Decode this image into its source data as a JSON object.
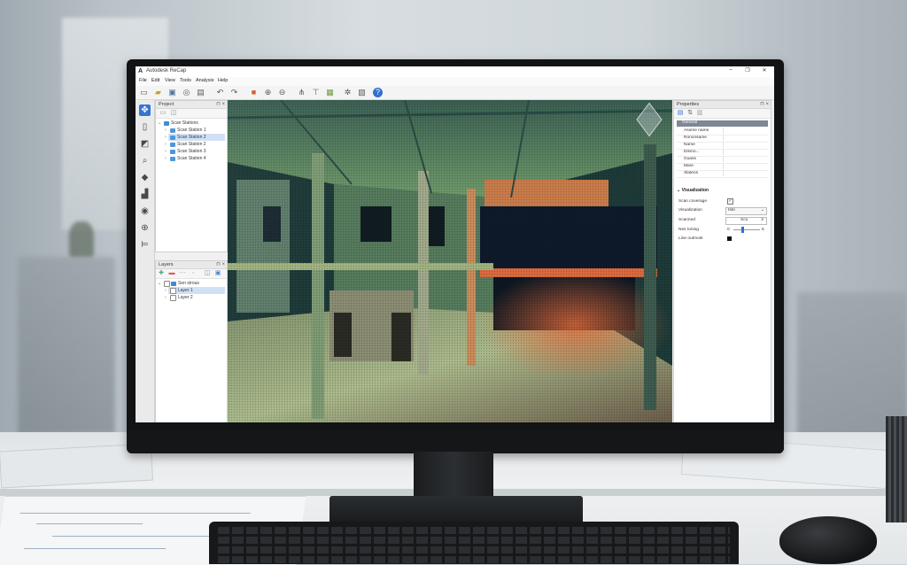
{
  "window": {
    "title": "Autodesk ReCap",
    "logo": "A",
    "controls": [
      "–",
      "❐",
      "✕"
    ]
  },
  "menu": {
    "items": [
      "File",
      "Edit",
      "View",
      "Tools",
      "Analysis",
      "Help"
    ]
  },
  "toolbar": {
    "icons": [
      "new-icon",
      "open-icon",
      "save-icon",
      "search-scan-icon",
      "print-icon",
      "undo-icon",
      "redo-icon",
      "cube-color-icon",
      "zoom-in-icon",
      "zoom-out-icon",
      "hierarchy-icon",
      "filter-icon",
      "chart-icon",
      "settings-icon",
      "report-icon",
      "help-icon"
    ]
  },
  "left_tools": {
    "icons": [
      "move-icon",
      "document-icon",
      "image-edit-icon",
      "search-icon",
      "box-icon",
      "stairs-icon",
      "target-icon",
      "add-circle-icon",
      "align-icon"
    ]
  },
  "project_panel": {
    "title": "Project",
    "root": "Scan Stations",
    "items": [
      "Scan Station 1",
      "Scan Station 2",
      "Scan Station 2",
      "Scan Station 3",
      "Scan Station 4"
    ],
    "selected_index": 1
  },
  "layers_panel": {
    "title": "Layers",
    "root": "Sen strous",
    "items": [
      "Layer 1",
      "Layer 2"
    ]
  },
  "properties_panel": {
    "title": "Properties",
    "group_label": "General",
    "rows": [
      "Asome name",
      "Rononsame",
      "Name",
      "Dismo...",
      "Guass",
      "Mare",
      "Xlateos"
    ],
    "visualization": {
      "title": "Visualization",
      "scan_coverage_label": "Scan coverage",
      "scan_coverage_checked": true,
      "visualization_label": "Visualization",
      "visualization_value": "Isto",
      "scanned_label": "Scanned",
      "scanned_value": "Sco",
      "scanned_count": "2",
      "nes_toning_label": "Nes toning",
      "nes_toning_min": "0",
      "nes_toning_max": "6",
      "nes_toning_level": 0.35,
      "line_outline_label": "Line outmost"
    }
  },
  "colors": {
    "accent": "#2f6fd1",
    "selection": "#cfe0f5"
  }
}
